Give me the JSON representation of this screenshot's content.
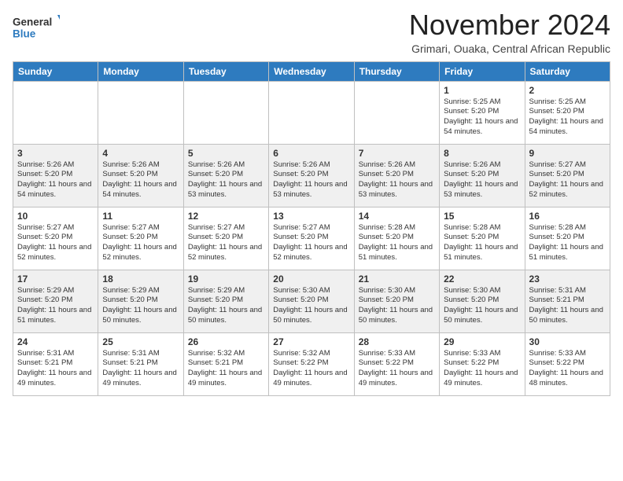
{
  "logo": {
    "line1": "General",
    "line2": "Blue"
  },
  "title": "November 2024",
  "subtitle": "Grimari, Ouaka, Central African Republic",
  "days_of_week": [
    "Sunday",
    "Monday",
    "Tuesday",
    "Wednesday",
    "Thursday",
    "Friday",
    "Saturday"
  ],
  "weeks": [
    [
      {
        "day": "",
        "info": ""
      },
      {
        "day": "",
        "info": ""
      },
      {
        "day": "",
        "info": ""
      },
      {
        "day": "",
        "info": ""
      },
      {
        "day": "",
        "info": ""
      },
      {
        "day": "1",
        "info": "Sunrise: 5:25 AM\nSunset: 5:20 PM\nDaylight: 11 hours\nand 54 minutes."
      },
      {
        "day": "2",
        "info": "Sunrise: 5:25 AM\nSunset: 5:20 PM\nDaylight: 11 hours\nand 54 minutes."
      }
    ],
    [
      {
        "day": "3",
        "info": "Sunrise: 5:26 AM\nSunset: 5:20 PM\nDaylight: 11 hours\nand 54 minutes."
      },
      {
        "day": "4",
        "info": "Sunrise: 5:26 AM\nSunset: 5:20 PM\nDaylight: 11 hours\nand 54 minutes."
      },
      {
        "day": "5",
        "info": "Sunrise: 5:26 AM\nSunset: 5:20 PM\nDaylight: 11 hours\nand 53 minutes."
      },
      {
        "day": "6",
        "info": "Sunrise: 5:26 AM\nSunset: 5:20 PM\nDaylight: 11 hours\nand 53 minutes."
      },
      {
        "day": "7",
        "info": "Sunrise: 5:26 AM\nSunset: 5:20 PM\nDaylight: 11 hours\nand 53 minutes."
      },
      {
        "day": "8",
        "info": "Sunrise: 5:26 AM\nSunset: 5:20 PM\nDaylight: 11 hours\nand 53 minutes."
      },
      {
        "day": "9",
        "info": "Sunrise: 5:27 AM\nSunset: 5:20 PM\nDaylight: 11 hours\nand 52 minutes."
      }
    ],
    [
      {
        "day": "10",
        "info": "Sunrise: 5:27 AM\nSunset: 5:20 PM\nDaylight: 11 hours\nand 52 minutes."
      },
      {
        "day": "11",
        "info": "Sunrise: 5:27 AM\nSunset: 5:20 PM\nDaylight: 11 hours\nand 52 minutes."
      },
      {
        "day": "12",
        "info": "Sunrise: 5:27 AM\nSunset: 5:20 PM\nDaylight: 11 hours\nand 52 minutes."
      },
      {
        "day": "13",
        "info": "Sunrise: 5:27 AM\nSunset: 5:20 PM\nDaylight: 11 hours\nand 52 minutes."
      },
      {
        "day": "14",
        "info": "Sunrise: 5:28 AM\nSunset: 5:20 PM\nDaylight: 11 hours\nand 51 minutes."
      },
      {
        "day": "15",
        "info": "Sunrise: 5:28 AM\nSunset: 5:20 PM\nDaylight: 11 hours\nand 51 minutes."
      },
      {
        "day": "16",
        "info": "Sunrise: 5:28 AM\nSunset: 5:20 PM\nDaylight: 11 hours\nand 51 minutes."
      }
    ],
    [
      {
        "day": "17",
        "info": "Sunrise: 5:29 AM\nSunset: 5:20 PM\nDaylight: 11 hours\nand 51 minutes."
      },
      {
        "day": "18",
        "info": "Sunrise: 5:29 AM\nSunset: 5:20 PM\nDaylight: 11 hours\nand 50 minutes."
      },
      {
        "day": "19",
        "info": "Sunrise: 5:29 AM\nSunset: 5:20 PM\nDaylight: 11 hours\nand 50 minutes."
      },
      {
        "day": "20",
        "info": "Sunrise: 5:30 AM\nSunset: 5:20 PM\nDaylight: 11 hours\nand 50 minutes."
      },
      {
        "day": "21",
        "info": "Sunrise: 5:30 AM\nSunset: 5:20 PM\nDaylight: 11 hours\nand 50 minutes."
      },
      {
        "day": "22",
        "info": "Sunrise: 5:30 AM\nSunset: 5:20 PM\nDaylight: 11 hours\nand 50 minutes."
      },
      {
        "day": "23",
        "info": "Sunrise: 5:31 AM\nSunset: 5:21 PM\nDaylight: 11 hours\nand 50 minutes."
      }
    ],
    [
      {
        "day": "24",
        "info": "Sunrise: 5:31 AM\nSunset: 5:21 PM\nDaylight: 11 hours\nand 49 minutes."
      },
      {
        "day": "25",
        "info": "Sunrise: 5:31 AM\nSunset: 5:21 PM\nDaylight: 11 hours\nand 49 minutes."
      },
      {
        "day": "26",
        "info": "Sunrise: 5:32 AM\nSunset: 5:21 PM\nDaylight: 11 hours\nand 49 minutes."
      },
      {
        "day": "27",
        "info": "Sunrise: 5:32 AM\nSunset: 5:22 PM\nDaylight: 11 hours\nand 49 minutes."
      },
      {
        "day": "28",
        "info": "Sunrise: 5:33 AM\nSunset: 5:22 PM\nDaylight: 11 hours\nand 49 minutes."
      },
      {
        "day": "29",
        "info": "Sunrise: 5:33 AM\nSunset: 5:22 PM\nDaylight: 11 hours\nand 49 minutes."
      },
      {
        "day": "30",
        "info": "Sunrise: 5:33 AM\nSunset: 5:22 PM\nDaylight: 11 hours\nand 48 minutes."
      }
    ]
  ]
}
